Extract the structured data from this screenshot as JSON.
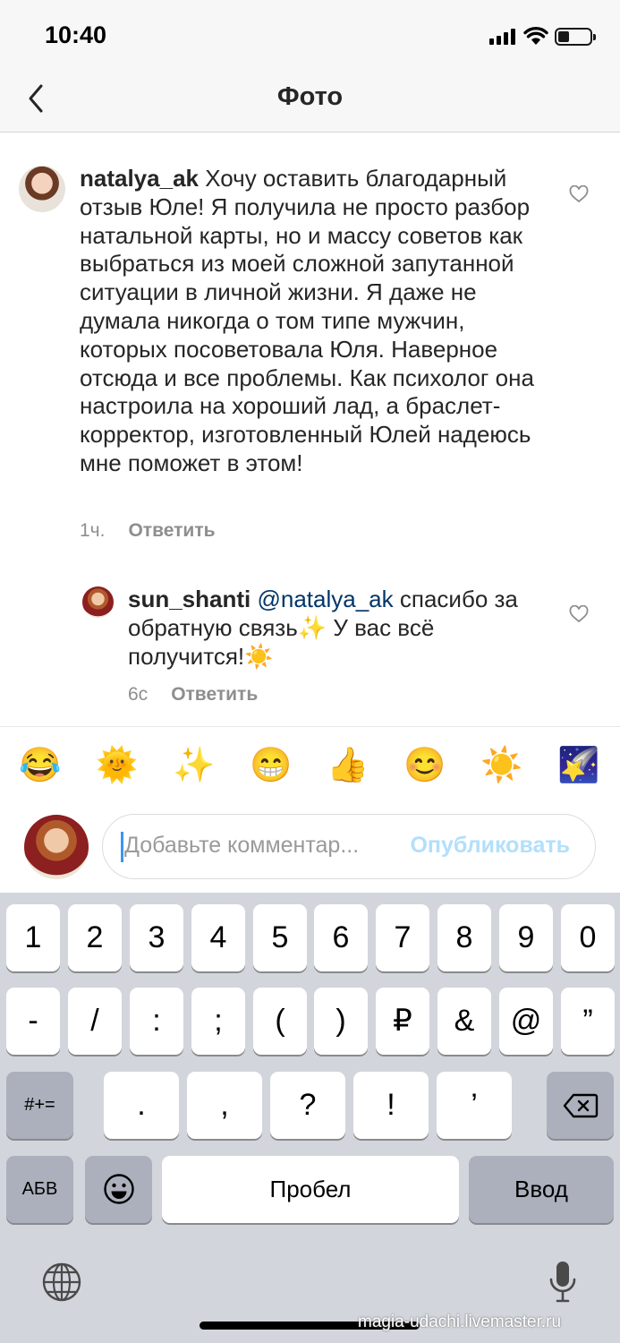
{
  "status_bar": {
    "time": "10:40"
  },
  "nav": {
    "title": "Фото",
    "back_icon": "chevron-left-icon"
  },
  "comments": [
    {
      "username": "natalya_ak",
      "text": "Хочу оставить благодарный отзыв Юле! Я получила не просто разбор натальной карты, но и массу советов как выбраться из моей сложной запутанной ситуации в личной жизни. Я даже не думала никогда о том типе мужчин, которых посоветовала Юля. Наверное отсюда и все проблемы. Как психолог она настроила на хороший лад, а браслет-корректор, изготовленный Юлей надеюсь мне поможет в этом!",
      "time": "1ч.",
      "reply_label": "Ответить"
    },
    {
      "username": "sun_shanti",
      "mention": "@natalya_ak",
      "text": "спасибо за обратную связь✨ У вас всё получится!☀️",
      "time": "6с",
      "reply_label": "Ответить"
    }
  ],
  "emoji_bar": [
    "😂",
    "🌞",
    "✨",
    "😁",
    "👍",
    "😊",
    "☀️",
    "🌠"
  ],
  "comment_input": {
    "placeholder": "Добавьте комментар...",
    "publish_label": "Опубликовать"
  },
  "keyboard": {
    "row1": [
      "1",
      "2",
      "3",
      "4",
      "5",
      "6",
      "7",
      "8",
      "9",
      "0"
    ],
    "row2": [
      "-",
      "/",
      ":",
      ";",
      "(",
      ")",
      "₽",
      "&",
      "@",
      "”"
    ],
    "row3_shift": "#+=",
    "row3": [
      ".",
      ",",
      "?",
      "!",
      "’"
    ],
    "layout_key": "АБВ",
    "space": "Пробел",
    "return": "Ввод"
  },
  "watermark": "magia-udachi.livemaster.ru"
}
